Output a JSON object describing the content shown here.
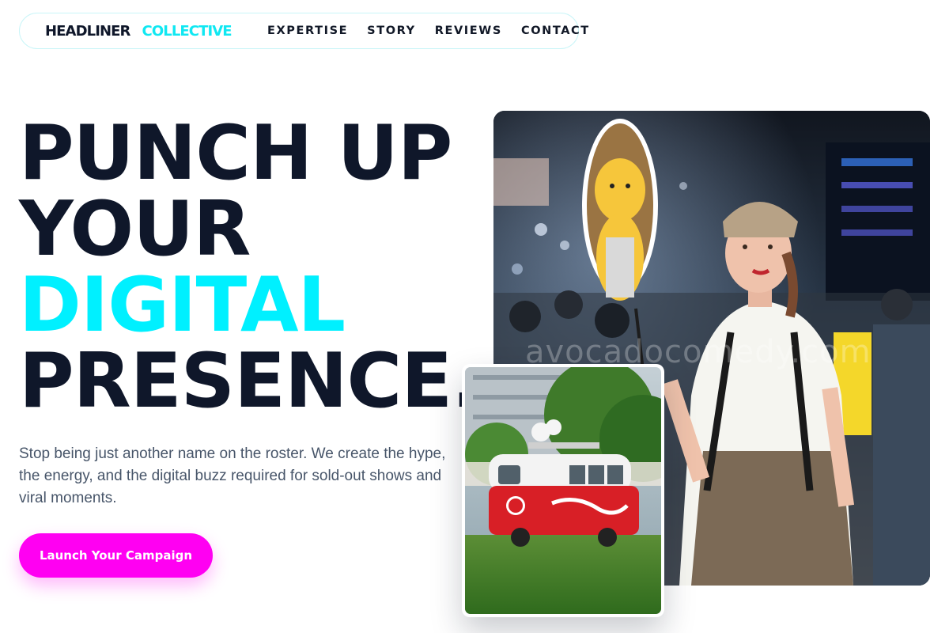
{
  "nav": {
    "logo_primary": "HEADLINER",
    "logo_accent": "COLLECTIVE",
    "links": [
      "EXPERTISE",
      "STORY",
      "REVIEWS",
      "CONTACT"
    ]
  },
  "hero": {
    "headline_line1": "PUNCH UP",
    "headline_line2": "YOUR",
    "headline_line3": "DIGITAL",
    "headline_line4": "PRESENCE.",
    "subtext": "Stop being just another name on the roster. We create the hype, the energy, and the digital buzz required for sold-out shows and viral moments.",
    "cta_label": "Launch Your Campaign"
  },
  "photos": {
    "main_watermark": "avocadocomedy.com"
  },
  "colors": {
    "ink": "#0f172a",
    "accent_cyan": "#00f0ff",
    "accent_magenta": "#ff00f2",
    "muted_text": "#475569"
  }
}
